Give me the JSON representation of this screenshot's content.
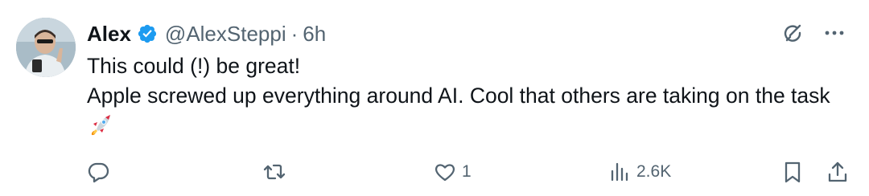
{
  "tweet": {
    "author_name": "Alex",
    "handle": "@AlexSteppi",
    "separator": "·",
    "time": "6h",
    "text_lines": [
      "This could (!) be great!",
      "Apple screwed up everything around AI. Cool that others are taking on the task"
    ],
    "emoji": "rocket-emoji",
    "verified": true
  },
  "actions": {
    "reply_count": "",
    "retweet_count": "",
    "like_count": "1",
    "views_count": "2.6K"
  },
  "icons": {
    "verified": "verified-badge-icon",
    "grok": "grok-icon",
    "more": "more-icon",
    "reply": "reply-icon",
    "retweet": "retweet-icon",
    "like": "heart-icon",
    "views": "views-icon",
    "bookmark": "bookmark-icon",
    "share": "share-icon"
  },
  "colors": {
    "text": "#0f1419",
    "secondary": "#536471",
    "verified": "#1d9bf0"
  }
}
